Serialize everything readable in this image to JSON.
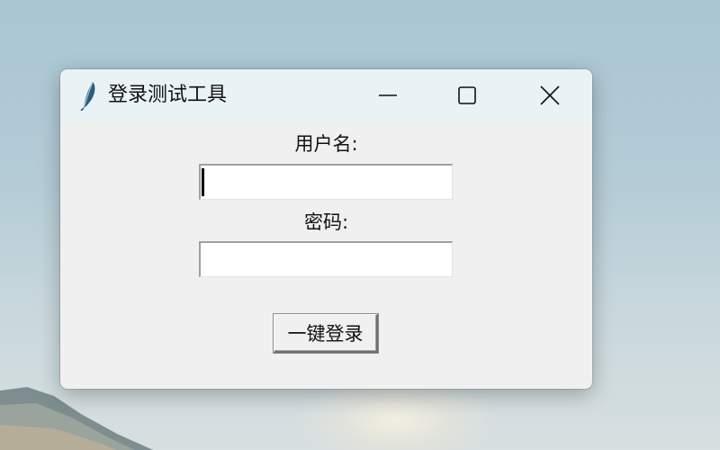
{
  "window": {
    "title": "登录测试工具",
    "icon": "feather-icon"
  },
  "titlebar_buttons": {
    "minimize": "minimize-icon",
    "maximize": "maximize-icon",
    "close": "close-icon"
  },
  "form": {
    "username_label": "用户名:",
    "username_value": "",
    "password_label": "密码:",
    "password_value": "",
    "login_button": "一键登录"
  }
}
